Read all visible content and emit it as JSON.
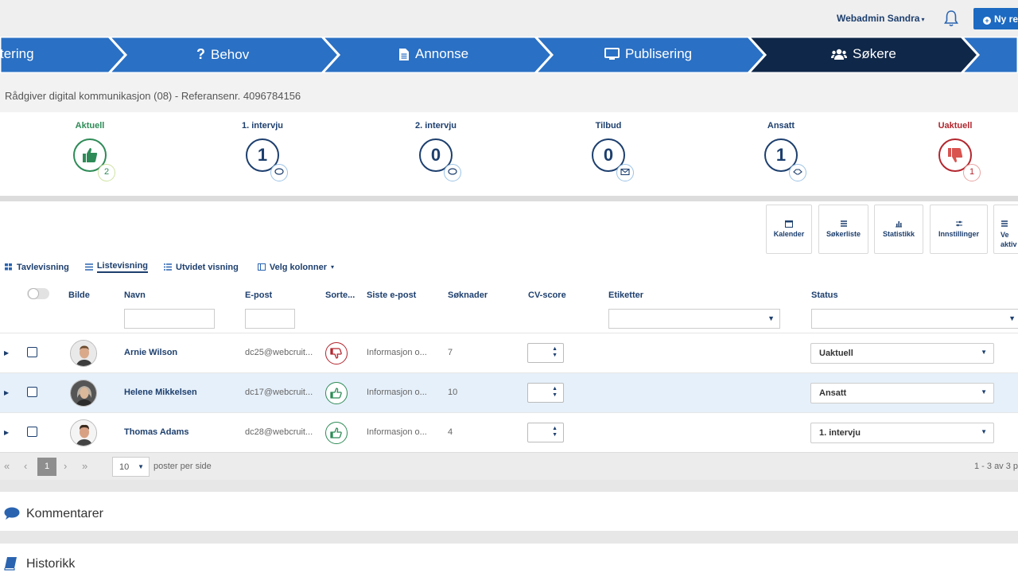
{
  "header": {
    "user": "Webadmin Sandra",
    "new_button": "Ny re"
  },
  "steps": [
    {
      "label": "tering",
      "icon": "none",
      "active": false
    },
    {
      "label": "Behov",
      "icon": "question-icon",
      "active": false
    },
    {
      "label": "Annonse",
      "icon": "document-icon",
      "active": false
    },
    {
      "label": "Publisering",
      "icon": "monitor-icon",
      "active": false
    },
    {
      "label": "Søkere",
      "icon": "users-icon",
      "active": true
    }
  ],
  "job_reference": "Rådgiver digital kommunikasjon (08) - Referansenr. 4096784156",
  "pipeline": [
    {
      "label": "Aktuell",
      "count": "",
      "badge": "2",
      "icon": "thumbs-up-icon",
      "color": "#2e8b57"
    },
    {
      "label": "1. intervju",
      "count": "1",
      "badge": "",
      "icon": "chat-icon",
      "color": "#1d3f6e"
    },
    {
      "label": "2. intervju",
      "count": "0",
      "badge": "",
      "icon": "chat-icon",
      "color": "#1d3f6e"
    },
    {
      "label": "Tilbud",
      "count": "0",
      "badge": "",
      "icon": "envelope-icon",
      "color": "#1d3f6e"
    },
    {
      "label": "Ansatt",
      "count": "1",
      "badge": "",
      "icon": "handshake-icon",
      "color": "#1d3f6e"
    },
    {
      "label": "Uaktuell",
      "count": "",
      "badge": "1",
      "icon": "thumbs-down-icon",
      "color": "#b3262e"
    }
  ],
  "toolbar": {
    "calendar": "Kalender",
    "applicant_list": "Søkerliste",
    "statistics": "Statistikk",
    "settings": "Innstillinger",
    "more": "Ve aktiv"
  },
  "views": {
    "board": "Tavlevisning",
    "list": "Listevisning",
    "extended": "Utvidet visning",
    "columns": "Velg kolonner"
  },
  "columns": {
    "picture": "Bilde",
    "name": "Navn",
    "email": "E-post",
    "sort": "Sorte...",
    "last_email": "Siste e-post",
    "applications": "Søknader",
    "cv_score": "CV-score",
    "tags": "Etiketter",
    "status": "Status"
  },
  "rows": [
    {
      "name": "Arnie Wilson",
      "email": "dc25@webcruit...",
      "rating": "down",
      "last_email": "Informasjon o...",
      "applications": "7",
      "status": "Uaktuell"
    },
    {
      "name": "Helene Mikkelsen",
      "email": "dc17@webcruit...",
      "rating": "up",
      "last_email": "Informasjon o...",
      "applications": "10",
      "status": "Ansatt"
    },
    {
      "name": "Thomas Adams",
      "email": "dc28@webcruit...",
      "rating": "up",
      "last_email": "Informasjon o...",
      "applications": "4",
      "status": "1. intervju"
    }
  ],
  "pager": {
    "current_page": "1",
    "page_size": "10",
    "per_page_label": "poster per side",
    "range": "1 - 3 av 3 p"
  },
  "panels": {
    "comments": "Kommentarer",
    "history": "Historikk"
  }
}
